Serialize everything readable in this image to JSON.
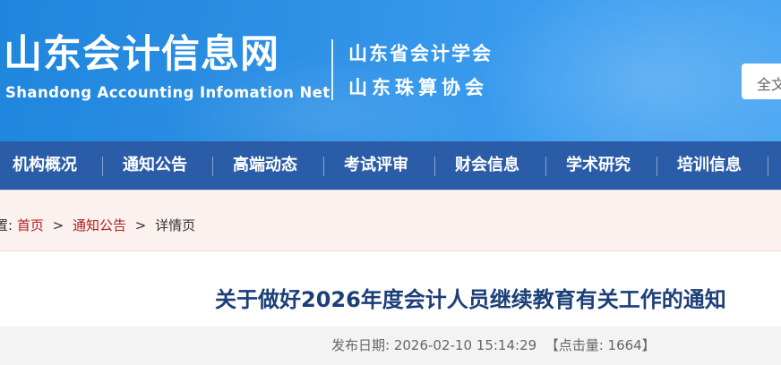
{
  "header": {
    "site_title": "山东会计信息网",
    "site_subtitle": "Shandong Accounting Infomation Net",
    "org_line1": "山东省会计学会",
    "org_line2": "山东珠算协会",
    "search_placeholder": "全文"
  },
  "nav": {
    "items": [
      {
        "label": "机构概况"
      },
      {
        "label": "通知公告"
      },
      {
        "label": "高端动态"
      },
      {
        "label": "考试评审"
      },
      {
        "label": "财会信息"
      },
      {
        "label": "学术研究"
      },
      {
        "label": "培训信息"
      }
    ]
  },
  "breadcrumb": {
    "prefix": "置:",
    "home": "首页",
    "section": "通知公告",
    "current": "详情页",
    "separator": ">"
  },
  "article": {
    "title": "关于做好2026年度会计人员继续教育有关工作的通知",
    "publish_label": "发布日期:",
    "publish_date": "2026-02-10 15:14:29",
    "clicks_label": "【点击量:",
    "clicks": "1664",
    "clicks_suffix": "】"
  },
  "colors": {
    "header_blue": "#2c8fe4",
    "nav_blue": "#2a5ca8",
    "link_red": "#b02020",
    "title_navy": "#1c3f78"
  }
}
